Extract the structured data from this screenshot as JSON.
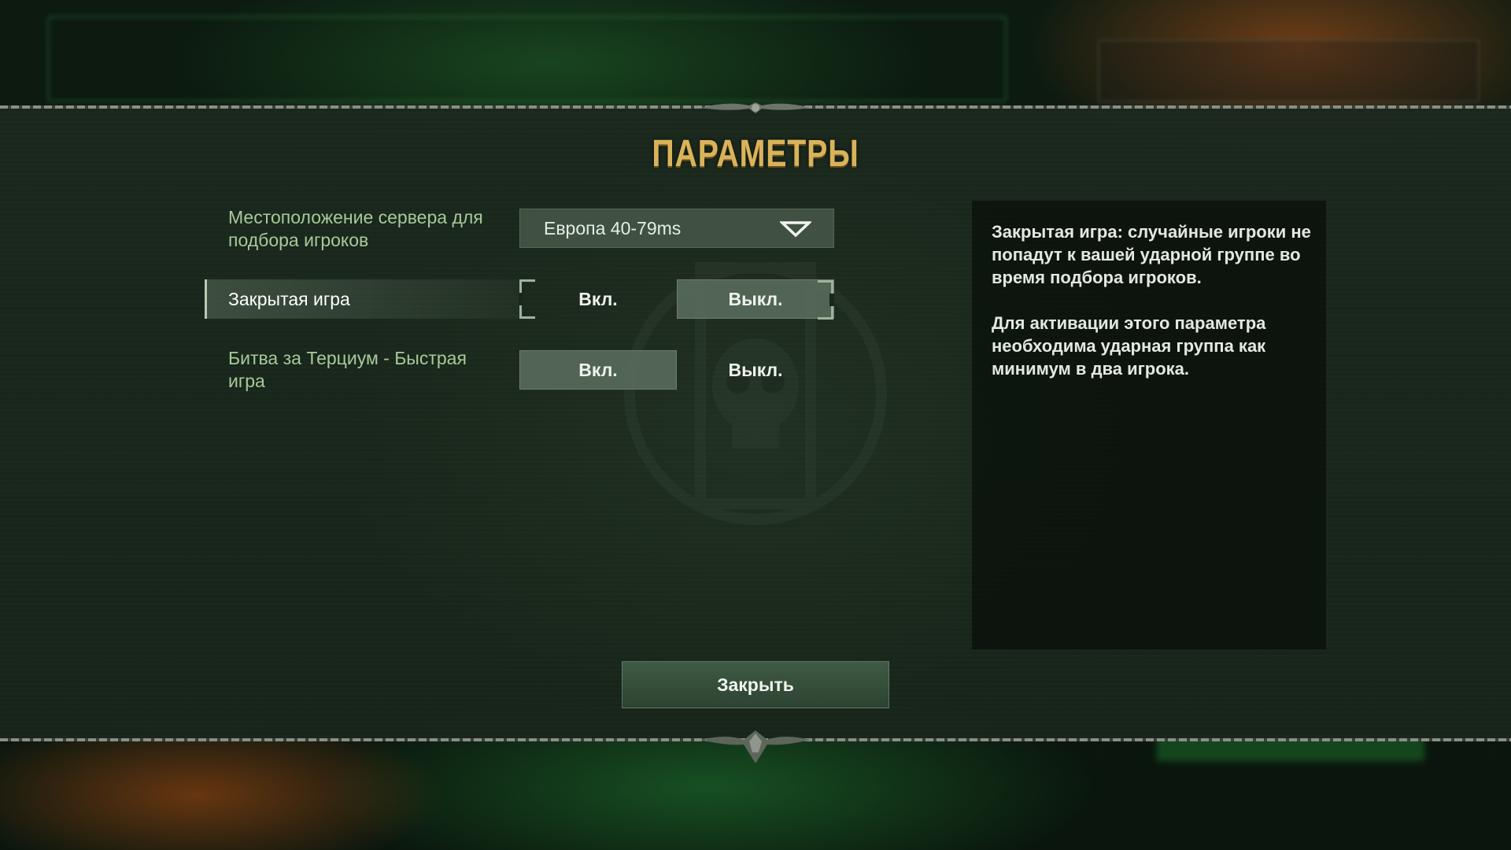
{
  "window": {
    "title": "ПАРАМЕТРЫ"
  },
  "settings": [
    {
      "label": "Местоположение сервера для подбора игроков",
      "type": "dropdown",
      "value": "Европа 40-79ms"
    },
    {
      "label": "Закрытая игра",
      "type": "toggle",
      "on_label": "Вкл.",
      "off_label": "Выкл.",
      "selected": "Выкл."
    },
    {
      "label": "Битва за Терциум - Быстрая игра",
      "type": "toggle",
      "on_label": "Вкл.",
      "off_label": "Выкл.",
      "selected": "Вкл."
    }
  ],
  "info": {
    "paragraph1": "Закрытая игра: случайные игроки не попадут к вашей ударной группе во время подбора игроков.",
    "paragraph2": "Для активации этого параметра необходима ударная группа как минимум в два игрока."
  },
  "close_button": {
    "label": "Закрыть"
  },
  "colors": {
    "title_gold": "#d9b35a",
    "label_green": "#a8c99a",
    "panel": "#1b281d"
  }
}
